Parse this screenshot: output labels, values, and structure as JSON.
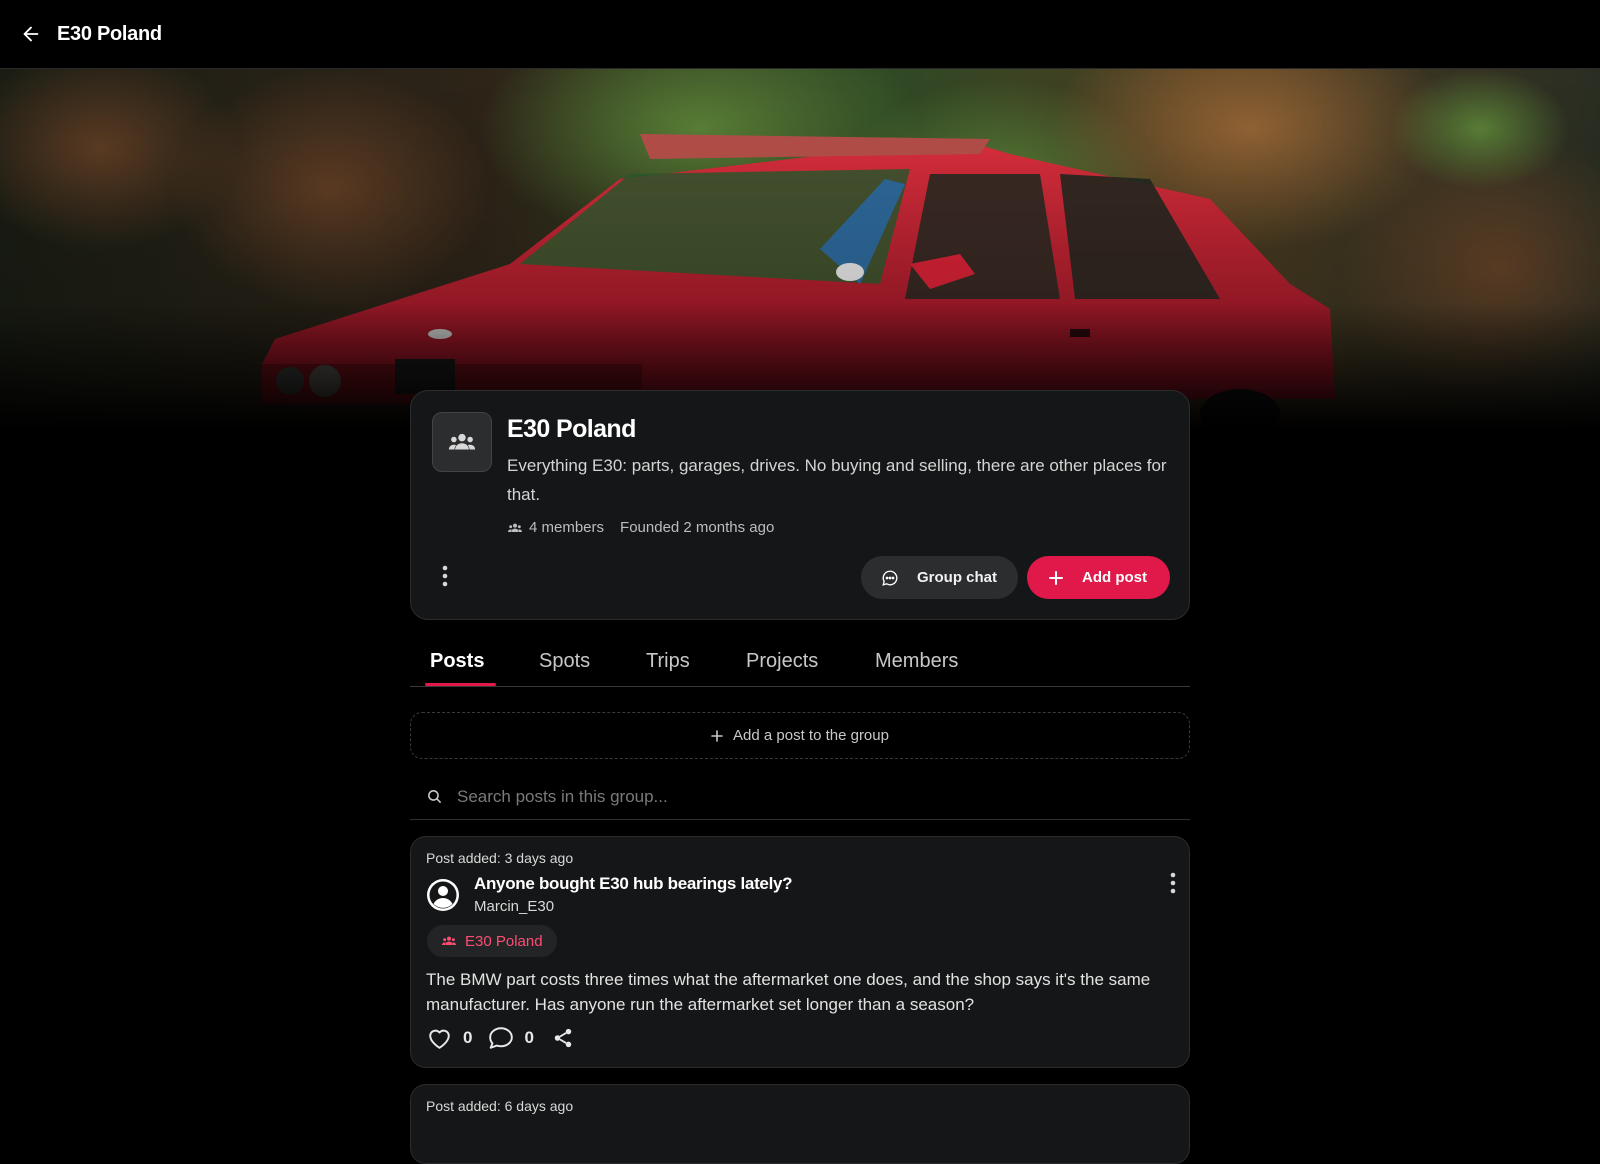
{
  "header": {
    "title": "E30 Poland",
    "back_icon": "arrow-left-icon"
  },
  "group": {
    "name": "E30 Poland",
    "description": "Everything E30: parts, garages, drives. No buying and selling, there are other places for that.",
    "members": "4 members",
    "founded": "Founded 2 months ago",
    "avatar_icon": "group-icon",
    "chat_label": "Group chat",
    "add_post_label": "Add post",
    "accent": "#e0194a"
  },
  "tabs": [
    {
      "label": "Posts",
      "active": true
    },
    {
      "label": "Spots",
      "active": false
    },
    {
      "label": "Trips",
      "active": false
    },
    {
      "label": "Projects",
      "active": false
    },
    {
      "label": "Members",
      "active": false
    }
  ],
  "add_post_prompt": "Add a post to the group",
  "search": {
    "placeholder": "Search posts in this group..."
  },
  "posts": [
    {
      "added": "Post added: 3 days ago",
      "title": "Anyone bought E30 hub bearings lately?",
      "author": "Marcin_E30",
      "group_chip": "E30 Poland",
      "body": "The BMW part costs three times what the aftermarket one does, and the shop says it's the same manufacturer. Has anyone run the aftermarket set longer than a season?",
      "likes": "0",
      "comments": "0"
    },
    {
      "added": "Post added: 6 days ago"
    }
  ]
}
